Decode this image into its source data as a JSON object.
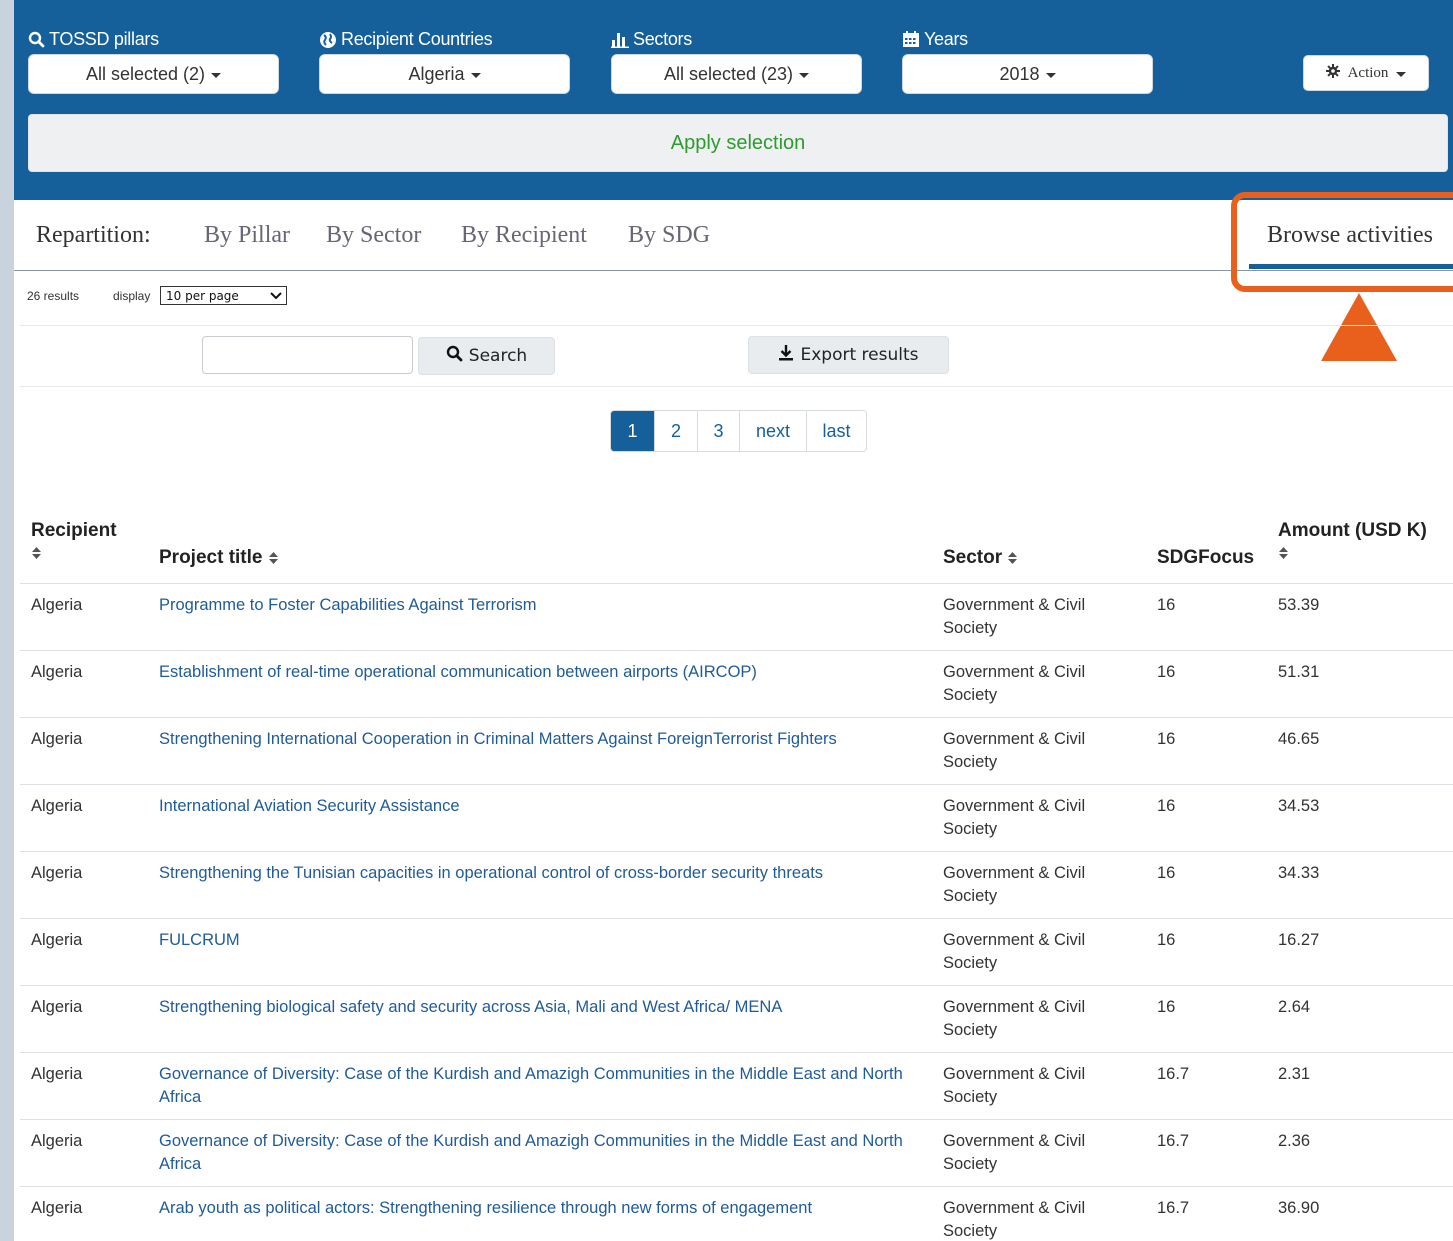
{
  "filters": {
    "pillars": {
      "label": "TOSSD pillars",
      "value": "All selected (2)"
    },
    "recipients": {
      "label": "Recipient Countries",
      "value": "Algeria"
    },
    "sectors": {
      "label": "Sectors",
      "value": "All selected (23)"
    },
    "years": {
      "label": "Years",
      "value": "2018"
    },
    "action_label": "Action",
    "apply_label": "Apply selection"
  },
  "tabs": {
    "prefix": "Repartition:",
    "items": [
      {
        "label": "By Pillar"
      },
      {
        "label": "By Sector"
      },
      {
        "label": "By Recipient"
      },
      {
        "label": "By SDG"
      }
    ],
    "active": "Browse activities"
  },
  "results": {
    "count": "26 results",
    "display_label": "display",
    "per_page": "10 per page"
  },
  "toolbar": {
    "search_label": "Search",
    "search_placeholder": "",
    "export_label": "Export results"
  },
  "pagination": {
    "pages": [
      "1",
      "2",
      "3",
      "next",
      "last"
    ],
    "current": "1"
  },
  "table": {
    "headers": {
      "recipient": "Recipient",
      "title": "Project title",
      "sector": "Sector",
      "sdg": "SDGFocus",
      "amount": "Amount (USD K)"
    },
    "rows": [
      {
        "recipient": "Algeria",
        "title": "Programme to Foster Capabilities Against Terrorism",
        "sector": "Government & Civil Society",
        "sdg": "16",
        "amount": "53.39"
      },
      {
        "recipient": "Algeria",
        "title": "Establishment of real-time operational communication between airports (AIRCOP)",
        "sector": "Government & Civil Society",
        "sdg": "16",
        "amount": "51.31"
      },
      {
        "recipient": "Algeria",
        "title": "Strengthening International Cooperation in Criminal Matters Against ForeignTerrorist Fighters",
        "sector": "Government & Civil Society",
        "sdg": "16",
        "amount": "46.65"
      },
      {
        "recipient": "Algeria",
        "title": "International Aviation Security Assistance",
        "sector": "Government & Civil Society",
        "sdg": "16",
        "amount": "34.53"
      },
      {
        "recipient": "Algeria",
        "title": "Strengthening the Tunisian capacities in operational control of cross-border security threats",
        "sector": "Government & Civil Society",
        "sdg": "16",
        "amount": "34.33"
      },
      {
        "recipient": "Algeria",
        "title": "FULCRUM",
        "sector": "Government & Civil Society",
        "sdg": "16",
        "amount": "16.27"
      },
      {
        "recipient": "Algeria",
        "title": "Strengthening biological safety and security across Asia, Mali and West Africa/ MENA",
        "sector": "Government & Civil Society",
        "sdg": "16",
        "amount": "2.64"
      },
      {
        "recipient": "Algeria",
        "title": "Governance of Diversity: Case of the Kurdish and Amazigh Communities in the Middle East and North Africa",
        "sector": "Government & Civil Society",
        "sdg": "16.7",
        "amount": "2.31"
      },
      {
        "recipient": "Algeria",
        "title": "Governance of Diversity: Case of the Kurdish and Amazigh Communities in the Middle East and North Africa",
        "sector": "Government & Civil Society",
        "sdg": "16.7",
        "amount": "2.36"
      },
      {
        "recipient": "Algeria",
        "title": "Arab youth as political actors: Strengthening resilience through new forms of engagement",
        "sector": "Government & Civil Society",
        "sdg": "16.7",
        "amount": "36.90"
      }
    ]
  },
  "colors": {
    "brand_blue": "#15609a",
    "link_blue": "#1f5b99",
    "apply_green": "#2e9b2e",
    "highlight_orange": "#e8601c"
  },
  "icons": {
    "pillars": "search-icon",
    "recipients": "globe-icon",
    "sectors": "bar-chart-icon",
    "years": "calendar-icon",
    "action": "gear-icon",
    "search": "search-icon",
    "export": "download-icon",
    "sort": "sort-icon",
    "annotation": "arrow-up-icon"
  }
}
